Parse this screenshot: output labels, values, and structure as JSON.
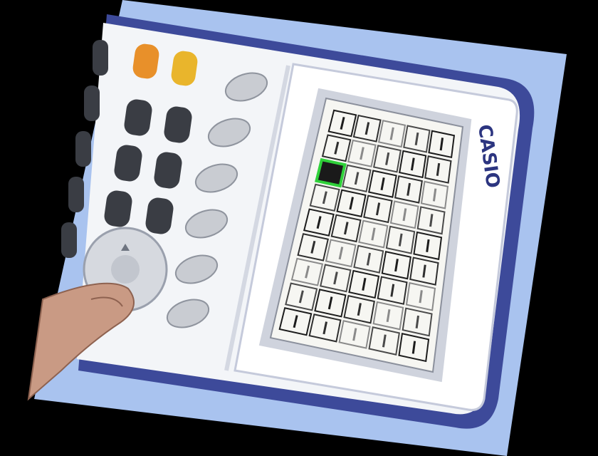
{
  "brand": {
    "text": "CASIO"
  },
  "screen": {
    "grid_rows": 9,
    "grid_cols": 5,
    "selected_cell": {
      "row": 2,
      "col": 0
    }
  },
  "colors": {
    "background": "#000000",
    "photo_backdrop": "#a9c3ef",
    "body": "#f3f5f8",
    "body_edge": "#3d4a9a",
    "trim": "#6b77c4",
    "screen_bezel": "#cfd3dd",
    "lcd": "#f6f6f2",
    "select_highlight": "#2fd13a",
    "key_dark": "#3a3d44",
    "key_orange": "#e8902a",
    "key_yellow": "#e9b52c",
    "key_light": "#c9ccd2",
    "finger": "#c99a84"
  }
}
